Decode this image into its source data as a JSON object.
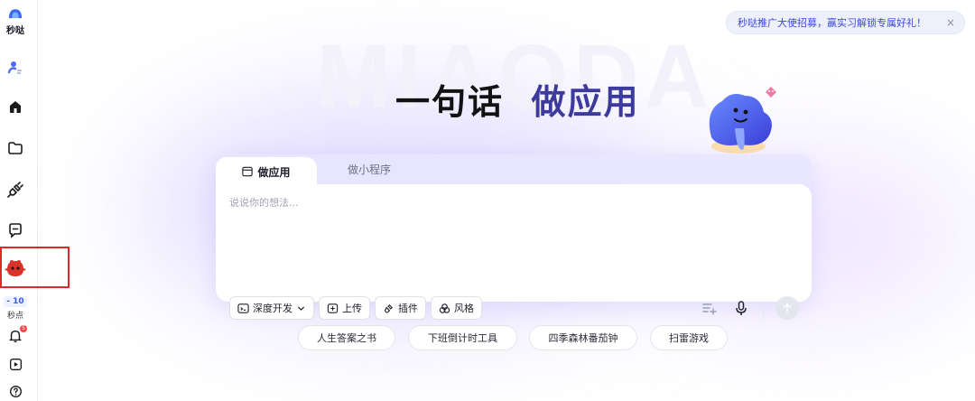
{
  "app": {
    "logo_text": "秒哒"
  },
  "sidebar": {
    "points_value": "- 10",
    "points_label": "秒点",
    "notification_count": "5"
  },
  "banner": {
    "text": "秒哒推广大使招募，赢实习解锁专属好礼！",
    "close": "×"
  },
  "watermark": "MIAODA",
  "hero": {
    "part1": "一句话",
    "part2": "做应用"
  },
  "composer": {
    "tab_active": "做应用",
    "tab_inactive": "做小程序",
    "placeholder": "说说你的想法...",
    "mode_chip": "深度开发",
    "upload": "上传",
    "plugin": "插件",
    "style": "风格"
  },
  "suggestions": [
    "人生答案之书",
    "下班倒计时工具",
    "四季森林番茄钟",
    "扫雷游戏"
  ],
  "colors": {
    "accent": "#3d3a9e",
    "highlight": "#e0282c",
    "banner_text": "#3a47d9"
  }
}
